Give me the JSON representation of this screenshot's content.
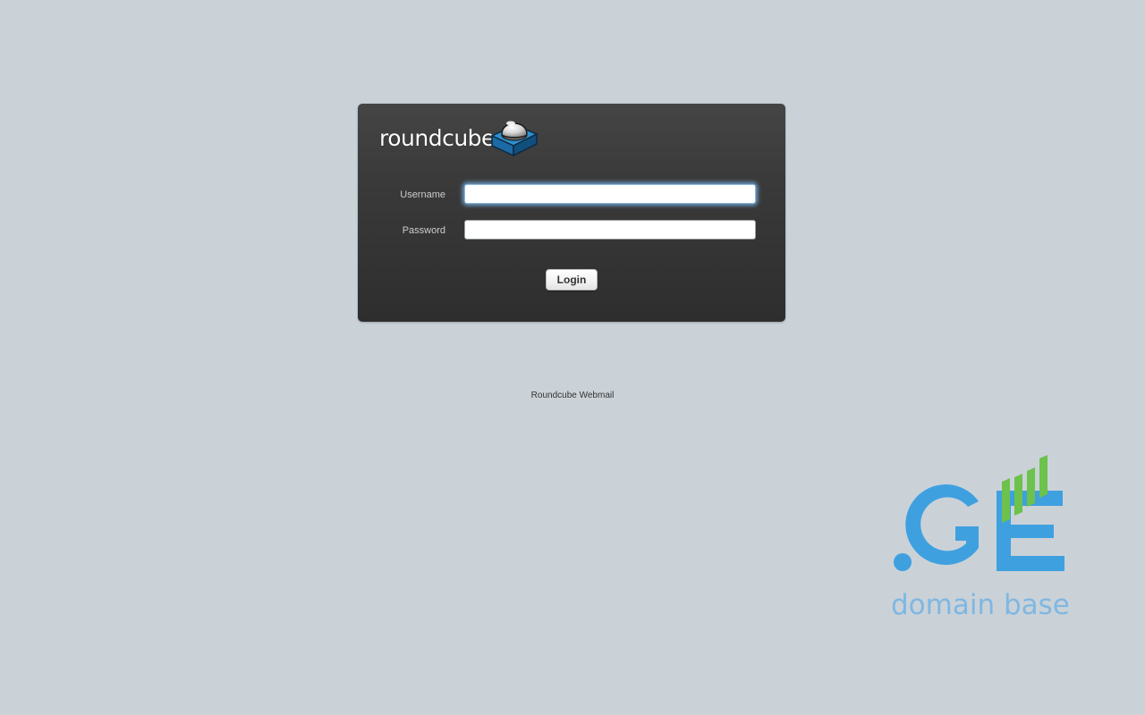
{
  "app": {
    "logo_text": "roundcube",
    "logo_icon": "roundcube-cube-icon"
  },
  "login_form": {
    "username_label": "Username",
    "username_value": "",
    "password_label": "Password",
    "password_value": "",
    "login_button": "Login"
  },
  "footer": {
    "text": "Roundcube Webmail"
  },
  "brand": {
    "logo_icon": "ge-domain-logo-icon",
    "tagline": "domain base",
    "colors": {
      "blue": "#3fa0e0",
      "green": "#6cc24a",
      "tagline": "#7fb7e2"
    }
  },
  "colors": {
    "background": "#cad2d8",
    "login_box": "#333333",
    "focus_glow": "#75b2e6"
  }
}
